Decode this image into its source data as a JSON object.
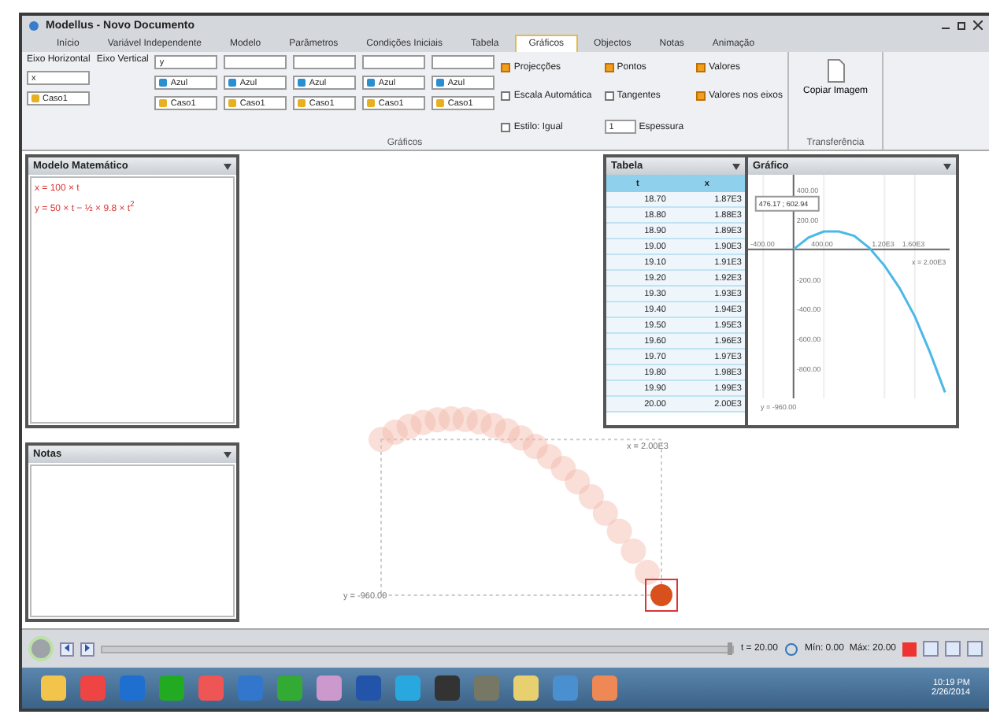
{
  "window": {
    "title": "Modellus - Novo Documento"
  },
  "tabs": [
    {
      "label": "Início",
      "selected": false
    },
    {
      "label": "Variável Independente",
      "selected": false
    },
    {
      "label": "Modelo",
      "selected": false
    },
    {
      "label": "Parâmetros",
      "selected": false
    },
    {
      "label": "Condições Iniciais",
      "selected": false
    },
    {
      "label": "Tabela",
      "selected": false
    },
    {
      "label": "Gráficos",
      "selected": true
    },
    {
      "label": "Objectos",
      "selected": false
    },
    {
      "label": "Notas",
      "selected": false
    },
    {
      "label": "Animação",
      "selected": false
    }
  ],
  "ribbon": {
    "horizontal_axis": {
      "label": "Eixo Horizontal",
      "variable": "x",
      "case": "Caso1"
    },
    "vertical_axis_label": "Eixo Vertical",
    "series_columns": [
      {
        "variable": "y",
        "color_label": "Azul",
        "color": "#2a8fd0",
        "case": "Caso1"
      },
      {
        "color_label": "Azul",
        "color": "#2a8fd0",
        "case": "Caso1"
      },
      {
        "color_label": "Azul",
        "color": "#2a8fd0",
        "case": "Caso1"
      },
      {
        "color_label": "Azul",
        "color": "#2a8fd0",
        "case": "Caso1"
      },
      {
        "color_label": "Azul",
        "color": "#2a8fd0",
        "case": "Caso1"
      }
    ],
    "options": [
      {
        "label": "Projecções",
        "checked": true
      },
      {
        "label": "Pontos",
        "checked": true
      },
      {
        "label": "Valores",
        "checked": true
      },
      {
        "label": "Escala Automática",
        "checked": false
      },
      {
        "label": "Tangentes",
        "checked": false
      },
      {
        "label": "Valores nos eixos",
        "checked": true
      },
      {
        "label": "Estilo: Igual",
        "checked": false
      }
    ],
    "thickness": {
      "value": "1",
      "label": "Espessura"
    },
    "group_label": "Gráficos",
    "copy_button": "Copiar Imagem",
    "copy_group_label": "Transferência"
  },
  "model_panel": {
    "title": "Modelo Matemático",
    "equations": [
      "x = 100 × t",
      "y = 50 × t − ½ × 9.8 × t$^{2}$"
    ]
  },
  "notes_panel": {
    "title": "Notas"
  },
  "table_panel": {
    "title": "Tabela",
    "columns": [
      "t",
      "x"
    ],
    "rows": [
      [
        "18.70",
        "1.87E3"
      ],
      [
        "18.80",
        "1.88E3"
      ],
      [
        "18.90",
        "1.89E3"
      ],
      [
        "19.00",
        "1.90E3"
      ],
      [
        "19.10",
        "1.91E3"
      ],
      [
        "19.20",
        "1.92E3"
      ],
      [
        "19.30",
        "1.93E3"
      ],
      [
        "19.40",
        "1.94E3"
      ],
      [
        "19.50",
        "1.95E3"
      ],
      [
        "19.60",
        "1.96E3"
      ],
      [
        "19.70",
        "1.97E3"
      ],
      [
        "19.80",
        "1.98E3"
      ],
      [
        "19.90",
        "1.99E3"
      ],
      [
        "20.00",
        "2.00E3"
      ]
    ]
  },
  "graph_panel": {
    "title": "Gráfico",
    "tooltip": "476.17 ; 602.94",
    "x_label": "x = 2.00E3",
    "y_label": "y = -960.00",
    "chart_data": {
      "type": "line",
      "x": [
        0,
        200,
        400,
        600,
        800,
        1000,
        1200,
        1400,
        1600,
        1800,
        2000
      ],
      "series": [
        {
          "color": "#4ab8e8",
          "values": [
            0,
            80,
            120,
            120,
            90,
            10,
            -110,
            -260,
            -450,
            -690,
            -960
          ]
        }
      ],
      "grid": true,
      "xlim": [
        -600,
        2060
      ],
      "ylim": [
        -1000,
        500
      ],
      "xticks": [
        {
          "value": -400,
          "label": "-400.00"
        },
        {
          "value": 400,
          "label": "400.00"
        },
        {
          "value": 1200,
          "label": "1.20E3"
        },
        {
          "value": 1600,
          "label": "1.60E3"
        }
      ],
      "yticks": [
        {
          "value": 400,
          "label": "400.00"
        },
        {
          "value": 200,
          "label": "200.00"
        },
        {
          "value": -200,
          "label": "-200.00"
        },
        {
          "value": -400,
          "label": "-400.00"
        },
        {
          "value": -600,
          "label": "-600.00"
        },
        {
          "value": -800,
          "label": "-800.00"
        }
      ]
    }
  },
  "animation": {
    "x_label": "x = 2.00E3",
    "y_label": "y = -960.00"
  },
  "controls": {
    "level": 1,
    "time": "t = 20.00",
    "range": "Mín: 0.00  Máx: 20.00"
  },
  "taskbar": {
    "time": "10:19 PM",
    "date": "2/26/2014"
  }
}
